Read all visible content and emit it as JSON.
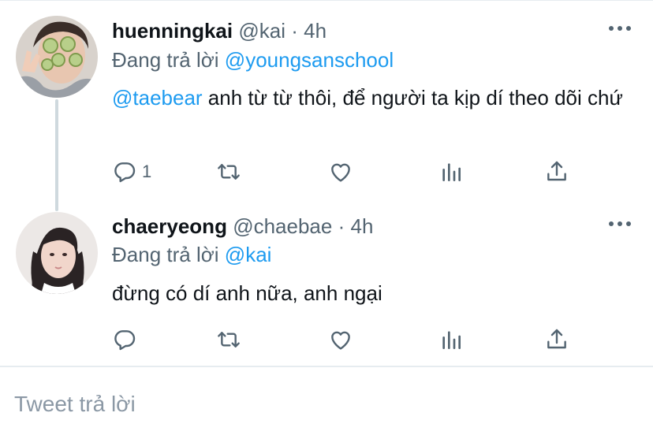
{
  "tweets": [
    {
      "name": "huenningkai",
      "handle": "@kai",
      "sep": "·",
      "time": "4h",
      "replying_prefix": "Đang trả lời",
      "replying_to": "@youngsanschool",
      "mention": "@taebear",
      "text": " anh từ từ thôi, để người ta kịp dí theo dõi chứ",
      "reply_count": "1"
    },
    {
      "name": "chaeryeong",
      "handle": "@chaebae",
      "sep": "·",
      "time": "4h",
      "replying_prefix": "Đang trả lời",
      "replying_to": "@kai",
      "text": "đừng có dí anh nữa, anh ngại",
      "reply_count": ""
    }
  ],
  "composer": {
    "placeholder": "Tweet trả lời"
  },
  "icons": [
    "more-icon",
    "reply-icon",
    "retweet-icon",
    "like-icon",
    "analytics-icon",
    "share-icon"
  ],
  "colors": {
    "link": "#1d9bf0",
    "muted": "#536471",
    "text": "#0f1419",
    "border": "#e6ecf0"
  }
}
